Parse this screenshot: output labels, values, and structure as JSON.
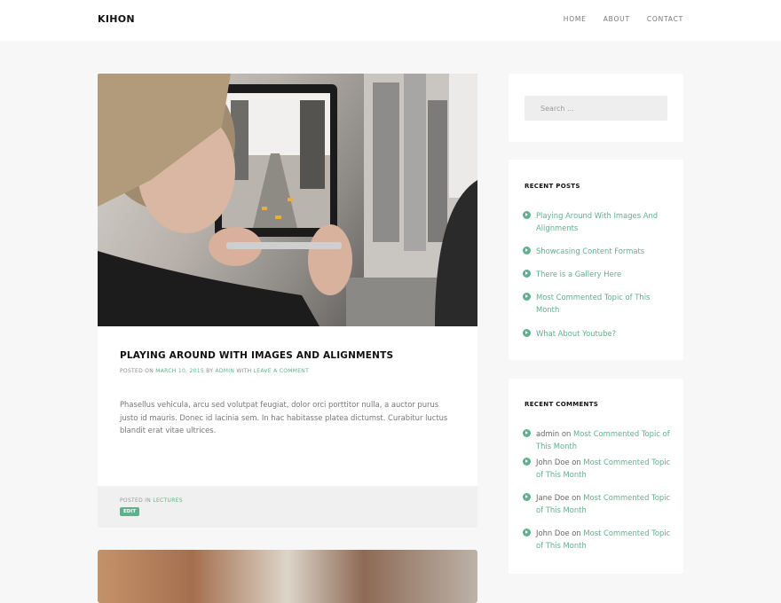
{
  "site": {
    "title": "KIHON",
    "nav": [
      "HOME",
      "ABOUT",
      "CONTACT"
    ]
  },
  "post": {
    "title": "PLAYING AROUND WITH IMAGES AND ALIGNMENTS",
    "meta": {
      "posted_on_label": "POSTED ON",
      "date": "MARCH 10, 2015",
      "by_label": "BY",
      "author": "ADMIN",
      "with_label": "WITH",
      "comment_link": "LEAVE A COMMENT"
    },
    "excerpt": "Phasellus vehicula, arcu sed volutpat feugiat, dolor orci porttitor nulla, a auctor purus justo id mauris. Donec id lacinia sem. In hac habitasse platea dictumst. Curabitur luctus blandit erat vitae ultrices.",
    "footer": {
      "posted_in_label": "POSTED IN",
      "category": "LECTURES",
      "edit_label": "EDIT"
    }
  },
  "sidebar": {
    "search": {
      "placeholder": "Search ..."
    },
    "recent_posts": {
      "title": "RECENT POSTS",
      "items": [
        "Playing Around With Images And Alignments",
        "Showcasing Content Formats",
        "There is a Gallery Here",
        "Most Commented Topic of This Month",
        "What About Youtube?"
      ]
    },
    "recent_comments": {
      "title": "RECENT COMMENTS",
      "on_label": "on",
      "items": [
        {
          "author": "admin",
          "post": "Most Commented Topic of This Month"
        },
        {
          "author": "John Doe",
          "post": "Most Commented Topic of This Month"
        },
        {
          "author": "Jane Doe",
          "post": "Most Commented Topic of This Month"
        },
        {
          "author": "John Doe",
          "post": "Most Commented Topic of This Month"
        }
      ]
    }
  },
  "colors": {
    "accent": "#5fb08d",
    "background": "#f7f7f7",
    "card": "#ffffff"
  }
}
